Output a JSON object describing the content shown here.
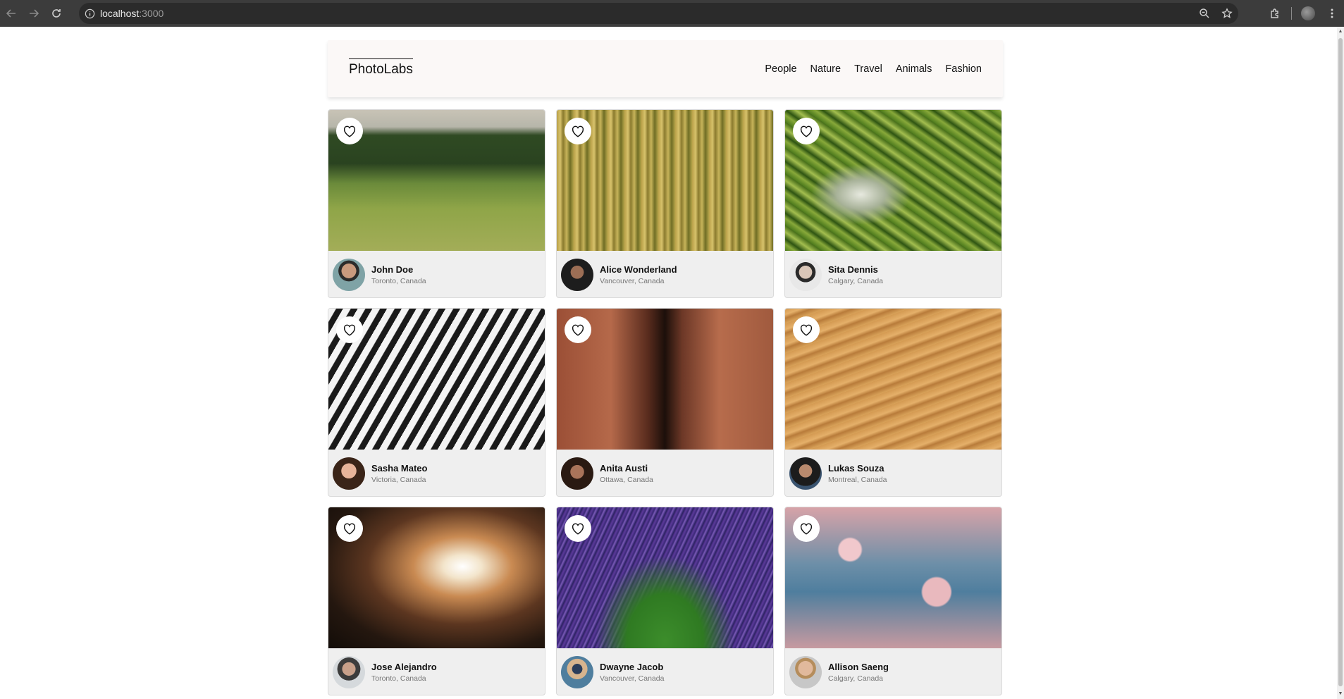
{
  "browser": {
    "url_host": "localhost",
    "url_port": ":3000"
  },
  "app": {
    "logo": "PhotoLabs",
    "topics": [
      "People",
      "Nature",
      "Travel",
      "Animals",
      "Fashion"
    ]
  },
  "photos": [
    {
      "name": "John Doe",
      "location": "Toronto, Canada"
    },
    {
      "name": "Alice Wonderland",
      "location": "Vancouver, Canada"
    },
    {
      "name": "Sita Dennis",
      "location": "Calgary, Canada"
    },
    {
      "name": "Sasha Mateo",
      "location": "Victoria, Canada"
    },
    {
      "name": "Anita Austi",
      "location": "Ottawa, Canada"
    },
    {
      "name": "Lukas Souza",
      "location": "Montreal, Canada"
    },
    {
      "name": "Jose Alejandro",
      "location": "Toronto, Canada"
    },
    {
      "name": "Dwayne Jacob",
      "location": "Vancouver, Canada"
    },
    {
      "name": "Allison Saeng",
      "location": "Calgary, Canada"
    }
  ]
}
